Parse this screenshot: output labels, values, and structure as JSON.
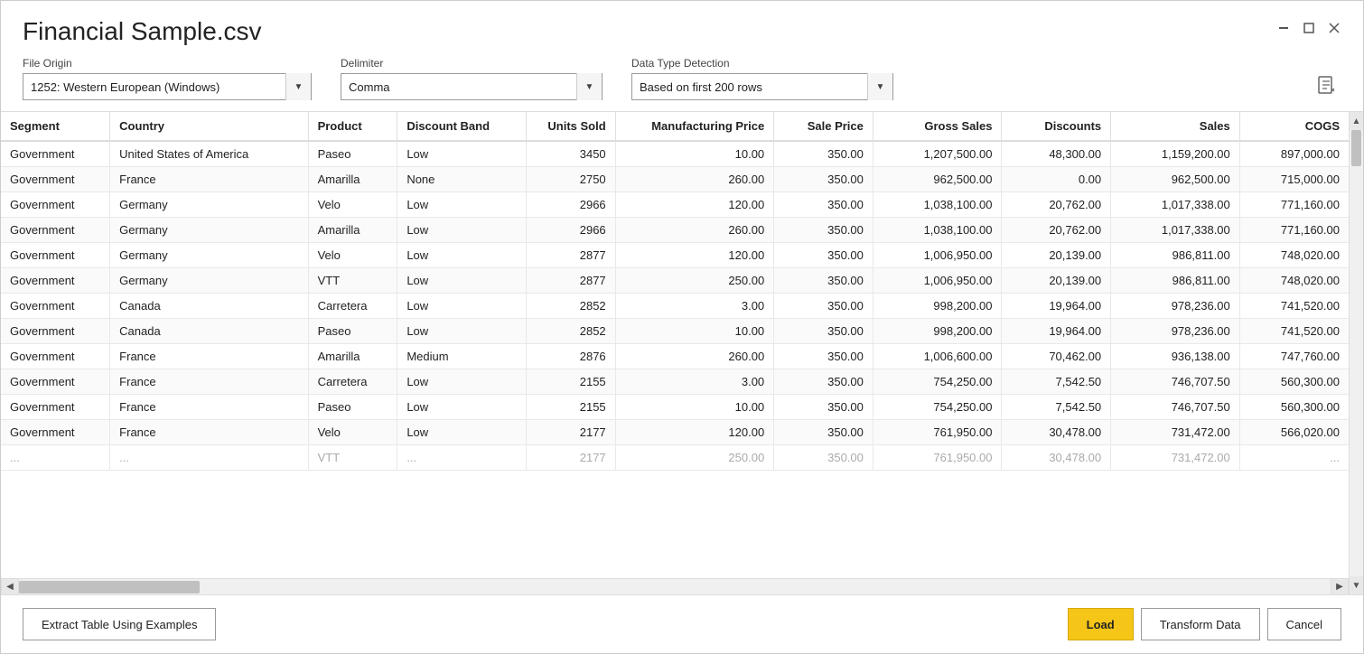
{
  "title": "Financial Sample.csv",
  "windowControls": {
    "minimize": "🗖",
    "close": "✕"
  },
  "fileOrigin": {
    "label": "File Origin",
    "value": "1252: Western European (Windows)"
  },
  "delimiter": {
    "label": "Delimiter",
    "value": "Comma"
  },
  "dataTypeDetection": {
    "label": "Data Type Detection",
    "value": "Based on first 200 rows"
  },
  "columns": [
    {
      "key": "segment",
      "label": "Segment",
      "class": "col-segment"
    },
    {
      "key": "country",
      "label": "Country",
      "class": "col-country"
    },
    {
      "key": "product",
      "label": "Product",
      "class": "col-product"
    },
    {
      "key": "discountBand",
      "label": "Discount Band",
      "class": "col-discount"
    },
    {
      "key": "unitsSold",
      "label": "Units Sold",
      "class": "col-units"
    },
    {
      "key": "mfgPrice",
      "label": "Manufacturing Price",
      "class": "col-mfg"
    },
    {
      "key": "salePrice",
      "label": "Sale Price",
      "class": "col-sale"
    },
    {
      "key": "grossSales",
      "label": "Gross Sales",
      "class": "col-gross"
    },
    {
      "key": "discounts",
      "label": "Discounts",
      "class": "col-discounts"
    },
    {
      "key": "sales",
      "label": "Sales",
      "class": "col-sales"
    },
    {
      "key": "cogs",
      "label": "COGS",
      "class": "col-cogs"
    }
  ],
  "rows": [
    {
      "segment": "Government",
      "country": "United States of America",
      "product": "Paseo",
      "discountBand": "Low",
      "unitsSold": "3450",
      "mfgPrice": "10.00",
      "salePrice": "350.00",
      "grossSales": "1,207,500.00",
      "discounts": "48,300.00",
      "sales": "1,159,200.00",
      "cogs": "897,000.00"
    },
    {
      "segment": "Government",
      "country": "France",
      "product": "Amarilla",
      "discountBand": "None",
      "unitsSold": "2750",
      "mfgPrice": "260.00",
      "salePrice": "350.00",
      "grossSales": "962,500.00",
      "discounts": "0.00",
      "sales": "962,500.00",
      "cogs": "715,000.00"
    },
    {
      "segment": "Government",
      "country": "Germany",
      "product": "Velo",
      "discountBand": "Low",
      "unitsSold": "2966",
      "mfgPrice": "120.00",
      "salePrice": "350.00",
      "grossSales": "1,038,100.00",
      "discounts": "20,762.00",
      "sales": "1,017,338.00",
      "cogs": "771,160.00"
    },
    {
      "segment": "Government",
      "country": "Germany",
      "product": "Amarilla",
      "discountBand": "Low",
      "unitsSold": "2966",
      "mfgPrice": "260.00",
      "salePrice": "350.00",
      "grossSales": "1,038,100.00",
      "discounts": "20,762.00",
      "sales": "1,017,338.00",
      "cogs": "771,160.00"
    },
    {
      "segment": "Government",
      "country": "Germany",
      "product": "Velo",
      "discountBand": "Low",
      "unitsSold": "2877",
      "mfgPrice": "120.00",
      "salePrice": "350.00",
      "grossSales": "1,006,950.00",
      "discounts": "20,139.00",
      "sales": "986,811.00",
      "cogs": "748,020.00"
    },
    {
      "segment": "Government",
      "country": "Germany",
      "product": "VTT",
      "discountBand": "Low",
      "unitsSold": "2877",
      "mfgPrice": "250.00",
      "salePrice": "350.00",
      "grossSales": "1,006,950.00",
      "discounts": "20,139.00",
      "sales": "986,811.00",
      "cogs": "748,020.00"
    },
    {
      "segment": "Government",
      "country": "Canada",
      "product": "Carretera",
      "discountBand": "Low",
      "unitsSold": "2852",
      "mfgPrice": "3.00",
      "salePrice": "350.00",
      "grossSales": "998,200.00",
      "discounts": "19,964.00",
      "sales": "978,236.00",
      "cogs": "741,520.00"
    },
    {
      "segment": "Government",
      "country": "Canada",
      "product": "Paseo",
      "discountBand": "Low",
      "unitsSold": "2852",
      "mfgPrice": "10.00",
      "salePrice": "350.00",
      "grossSales": "998,200.00",
      "discounts": "19,964.00",
      "sales": "978,236.00",
      "cogs": "741,520.00"
    },
    {
      "segment": "Government",
      "country": "France",
      "product": "Amarilla",
      "discountBand": "Medium",
      "unitsSold": "2876",
      "mfgPrice": "260.00",
      "salePrice": "350.00",
      "grossSales": "1,006,600.00",
      "discounts": "70,462.00",
      "sales": "936,138.00",
      "cogs": "747,760.00"
    },
    {
      "segment": "Government",
      "country": "France",
      "product": "Carretera",
      "discountBand": "Low",
      "unitsSold": "2155",
      "mfgPrice": "3.00",
      "salePrice": "350.00",
      "grossSales": "754,250.00",
      "discounts": "7,542.50",
      "sales": "746,707.50",
      "cogs": "560,300.00"
    },
    {
      "segment": "Government",
      "country": "France",
      "product": "Paseo",
      "discountBand": "Low",
      "unitsSold": "2155",
      "mfgPrice": "10.00",
      "salePrice": "350.00",
      "grossSales": "754,250.00",
      "discounts": "7,542.50",
      "sales": "746,707.50",
      "cogs": "560,300.00"
    },
    {
      "segment": "Government",
      "country": "France",
      "product": "Velo",
      "discountBand": "Low",
      "unitsSold": "2177",
      "mfgPrice": "120.00",
      "salePrice": "350.00",
      "grossSales": "761,950.00",
      "discounts": "30,478.00",
      "sales": "731,472.00",
      "cogs": "566,020.00"
    }
  ],
  "partialRow": {
    "segment": "...",
    "country": "...",
    "product": "VTT",
    "discountBand": "...",
    "unitsSold": "2177",
    "mfgPrice": "250.00",
    "salePrice": "350.00",
    "grossSales": "761,950.00",
    "discounts": "30,478.00",
    "sales": "731,472.00",
    "cogs": "..."
  },
  "footer": {
    "extractBtn": "Extract Table Using Examples",
    "loadBtn": "Load",
    "transformBtn": "Transform Data",
    "cancelBtn": "Cancel"
  }
}
